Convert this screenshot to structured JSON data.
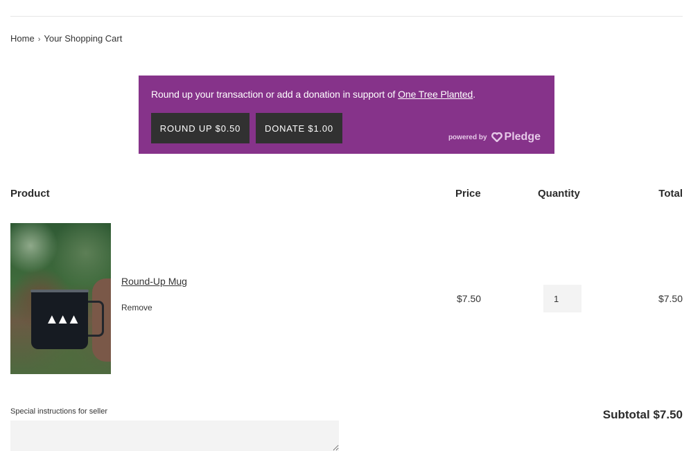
{
  "breadcrumb": {
    "home": "Home",
    "separator": "›",
    "current": "Your Shopping Cart"
  },
  "pledge": {
    "message_prefix": "Round up your transaction or add a donation in support of ",
    "charity_link": "One Tree Planted",
    "message_suffix": ".",
    "round_up_button": "ROUND UP $0.50",
    "donate_button": "DONATE $1.00",
    "powered_by": "powered by",
    "brand": "Pledge",
    "colors": {
      "banner": "#86338a",
      "button": "#313131"
    }
  },
  "table": {
    "headers": {
      "product": "Product",
      "price": "Price",
      "quantity": "Quantity",
      "total": "Total"
    },
    "rows": [
      {
        "name": "Round-Up Mug",
        "remove": "Remove",
        "price": "$7.50",
        "quantity": "1",
        "total": "$7.50",
        "image_icon": "mug-with-trees-image"
      }
    ]
  },
  "footer": {
    "instructions_label": "Special instructions for seller",
    "instructions_value": "",
    "subtotal": "Subtotal $7.50"
  }
}
